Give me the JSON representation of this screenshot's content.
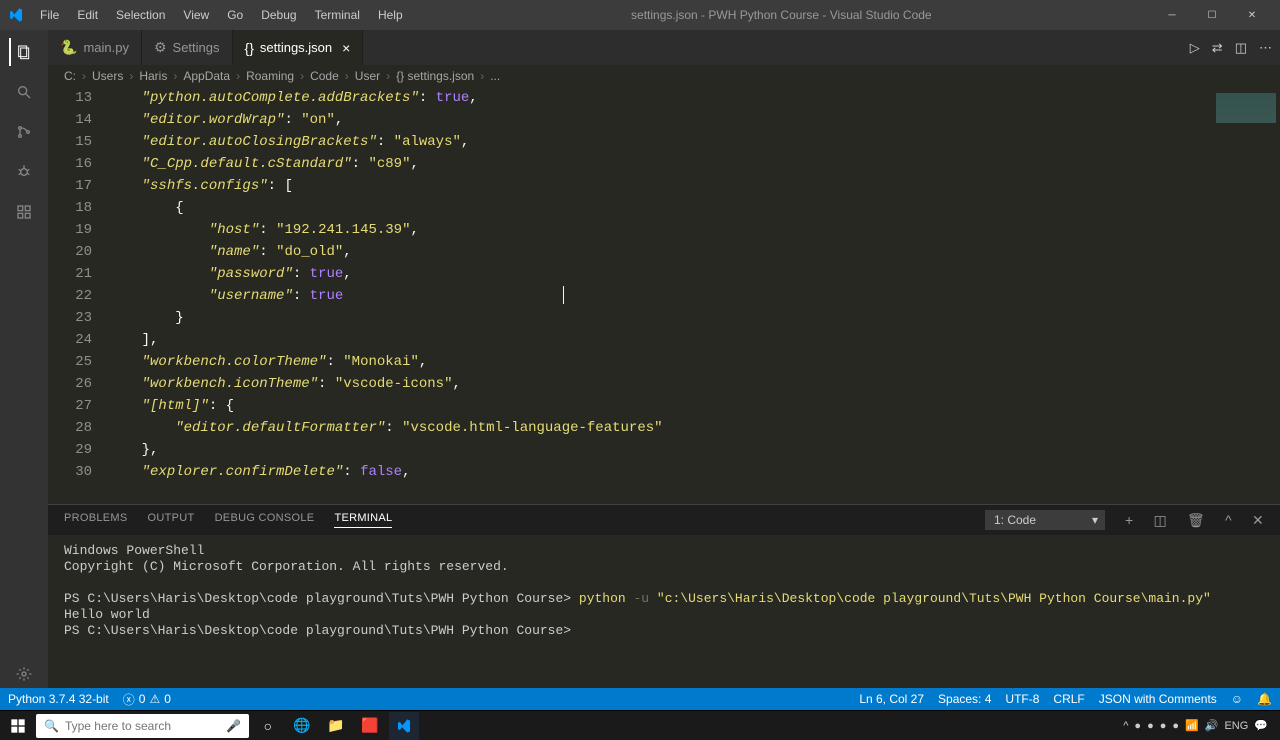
{
  "titlebar": {
    "menus": [
      "File",
      "Edit",
      "Selection",
      "View",
      "Go",
      "Debug",
      "Terminal",
      "Help"
    ],
    "title": "settings.json - PWH Python Course - Visual Studio Code"
  },
  "tabs": [
    {
      "icon": "🐍",
      "label": "main.py",
      "active": false
    },
    {
      "icon": "⚙",
      "label": "Settings",
      "active": false
    },
    {
      "icon": "{}",
      "label": "settings.json",
      "active": true
    }
  ],
  "breadcrumbs": [
    "C:",
    "Users",
    "Haris",
    "AppData",
    "Roaming",
    "Code",
    "User",
    "{} settings.json",
    "..."
  ],
  "editor": {
    "startLine": 13,
    "lines": [
      [
        {
          "t": "    ",
          "c": ""
        },
        {
          "t": "\"python.autoComplete.addBrackets\"",
          "c": "key"
        },
        {
          "t": ": ",
          "c": "punc"
        },
        {
          "t": "true",
          "c": "bool"
        },
        {
          "t": ",",
          "c": "punc"
        }
      ],
      [
        {
          "t": "    ",
          "c": ""
        },
        {
          "t": "\"editor.wordWrap\"",
          "c": "key"
        },
        {
          "t": ": ",
          "c": "punc"
        },
        {
          "t": "\"on\"",
          "c": "str"
        },
        {
          "t": ",",
          "c": "punc"
        }
      ],
      [
        {
          "t": "    ",
          "c": ""
        },
        {
          "t": "\"editor.autoClosingBrackets\"",
          "c": "key"
        },
        {
          "t": ": ",
          "c": "punc"
        },
        {
          "t": "\"always\"",
          "c": "str"
        },
        {
          "t": ",",
          "c": "punc"
        }
      ],
      [
        {
          "t": "    ",
          "c": ""
        },
        {
          "t": "\"C_Cpp.default.cStandard\"",
          "c": "key"
        },
        {
          "t": ": ",
          "c": "punc"
        },
        {
          "t": "\"c89\"",
          "c": "str"
        },
        {
          "t": ",",
          "c": "punc"
        }
      ],
      [
        {
          "t": "    ",
          "c": ""
        },
        {
          "t": "\"sshfs.configs\"",
          "c": "key"
        },
        {
          "t": ": [",
          "c": "punc"
        }
      ],
      [
        {
          "t": "        {",
          "c": "punc"
        }
      ],
      [
        {
          "t": "            ",
          "c": ""
        },
        {
          "t": "\"host\"",
          "c": "key"
        },
        {
          "t": ": ",
          "c": "punc"
        },
        {
          "t": "\"192.241.145.39\"",
          "c": "str"
        },
        {
          "t": ",",
          "c": "punc"
        }
      ],
      [
        {
          "t": "            ",
          "c": ""
        },
        {
          "t": "\"name\"",
          "c": "key"
        },
        {
          "t": ": ",
          "c": "punc"
        },
        {
          "t": "\"do_old\"",
          "c": "str"
        },
        {
          "t": ",",
          "c": "punc"
        }
      ],
      [
        {
          "t": "            ",
          "c": ""
        },
        {
          "t": "\"password\"",
          "c": "key"
        },
        {
          "t": ": ",
          "c": "punc"
        },
        {
          "t": "true",
          "c": "bool"
        },
        {
          "t": ",",
          "c": "punc"
        }
      ],
      [
        {
          "t": "            ",
          "c": ""
        },
        {
          "t": "\"username\"",
          "c": "key"
        },
        {
          "t": ": ",
          "c": "punc"
        },
        {
          "t": "true",
          "c": "bool"
        }
      ],
      [
        {
          "t": "        }",
          "c": "punc"
        }
      ],
      [
        {
          "t": "    ],",
          "c": "punc"
        }
      ],
      [
        {
          "t": "    ",
          "c": ""
        },
        {
          "t": "\"workbench.colorTheme\"",
          "c": "key"
        },
        {
          "t": ": ",
          "c": "punc"
        },
        {
          "t": "\"Monokai\"",
          "c": "str"
        },
        {
          "t": ",",
          "c": "punc"
        }
      ],
      [
        {
          "t": "    ",
          "c": ""
        },
        {
          "t": "\"workbench.iconTheme\"",
          "c": "key"
        },
        {
          "t": ": ",
          "c": "punc"
        },
        {
          "t": "\"vscode-icons\"",
          "c": "str"
        },
        {
          "t": ",",
          "c": "punc"
        }
      ],
      [
        {
          "t": "    ",
          "c": ""
        },
        {
          "t": "\"[html]\"",
          "c": "key"
        },
        {
          "t": ": {",
          "c": "punc"
        }
      ],
      [
        {
          "t": "        ",
          "c": ""
        },
        {
          "t": "\"editor.defaultFormatter\"",
          "c": "key"
        },
        {
          "t": ": ",
          "c": "punc"
        },
        {
          "t": "\"vscode.html-language-features\"",
          "c": "str"
        }
      ],
      [
        {
          "t": "    },",
          "c": "punc"
        }
      ],
      [
        {
          "t": "    ",
          "c": ""
        },
        {
          "t": "\"explorer.confirmDelete\"",
          "c": "key"
        },
        {
          "t": ": ",
          "c": "punc"
        },
        {
          "t": "false",
          "c": "bool"
        },
        {
          "t": ",",
          "c": "punc"
        }
      ]
    ]
  },
  "panel": {
    "tabs": [
      "PROBLEMS",
      "OUTPUT",
      "DEBUG CONSOLE",
      "TERMINAL"
    ],
    "activeTab": 3,
    "termSelect": "1: Code"
  },
  "terminal": {
    "lines": [
      "Windows PowerShell",
      "Copyright (C) Microsoft Corporation. All rights reserved.",
      "",
      {
        "parts": [
          {
            "t": "PS C:\\Users\\Haris\\Desktop\\code playground\\Tuts\\PWH Python Course> ",
            "c": ""
          },
          {
            "t": "python ",
            "c": "cmd-yellow"
          },
          {
            "t": "-u ",
            "c": "cmd-arg"
          },
          {
            "t": "\"c:\\Users\\Haris\\Desktop\\code playground\\Tuts\\PWH Python Course\\main.py\"",
            "c": "cmd-str"
          }
        ]
      },
      "Hello world",
      "PS C:\\Users\\Haris\\Desktop\\code playground\\Tuts\\PWH Python Course>"
    ]
  },
  "statusbar": {
    "python": "Python 3.7.4 32-bit",
    "errors": "0",
    "warnings": "0",
    "lncol": "Ln 6, Col 27",
    "spaces": "Spaces: 4",
    "encoding": "UTF-8",
    "eol": "CRLF",
    "lang": "JSON with Comments"
  },
  "taskbar": {
    "searchPlaceholder": "Type here to search",
    "tray": {
      "lang": "ENG"
    }
  }
}
